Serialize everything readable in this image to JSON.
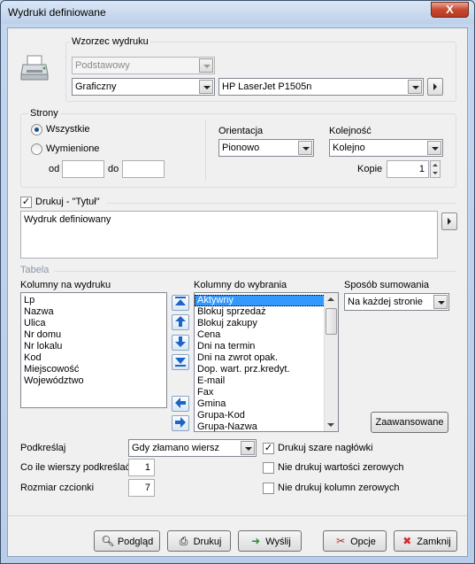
{
  "window": {
    "title": "Wydruki definiowane",
    "close_label": "X"
  },
  "wzorzec": {
    "label": "Wzorzec wydruku",
    "template_value": "Podstawowy",
    "mode_value": "Graficzny",
    "printer_value": "HP LaserJet P1505n"
  },
  "strony": {
    "label": "Strony",
    "all_label": "Wszystkie",
    "listed_label": "Wymienione",
    "from_label": "od",
    "from_value": "",
    "to_label": "do",
    "to_value": ""
  },
  "orientacja": {
    "label": "Orientacja",
    "value": "Pionowo"
  },
  "kolejnosc": {
    "label": "Kolejność",
    "value": "Kolejno"
  },
  "kopie": {
    "label": "Kopie",
    "value": "1"
  },
  "title_section": {
    "checkbox_label": "Drukuj - \"Tytuł\"",
    "text": "Wydruk definiowany"
  },
  "tabela": {
    "label": "Tabela",
    "print_columns_label": "Kolumny na wydruku",
    "print_columns": [
      "Lp",
      "Nazwa",
      "Ulica",
      "Nr domu",
      "Nr lokalu",
      "Kod",
      "Miejscowość",
      "Województwo"
    ],
    "available_columns_label": "Kolumny do wybrania",
    "available_columns": [
      "Aktywny",
      "Blokuj sprzedaż",
      "Blokuj zakupy",
      "Cena",
      "Dni na termin",
      "Dni na zwrot opak.",
      "Dop. wart. prz.kredyt.",
      "E-mail",
      "Fax",
      "Gmina",
      "Grupa-Kod",
      "Grupa-Nazwa"
    ],
    "selected_available": "Aktywny",
    "summing_label": "Sposób sumowania",
    "summing_value": "Na każdej stronie",
    "advanced_label": "Zaawansowane"
  },
  "options": {
    "underline_label": "Podkreślaj",
    "underline_value": "Gdy złamano wiersz",
    "every_rows_label": "Co ile wierszy podkreślać",
    "every_rows_value": "1",
    "font_size_label": "Rozmiar czcionki",
    "font_size_value": "7",
    "gray_headers_label": "Drukuj szare nagłówki",
    "no_zero_values_label": "Nie drukuj wartości zerowych",
    "no_zero_columns_label": "Nie drukuj kolumn zerowych"
  },
  "buttons": {
    "preview": "Podgląd",
    "print": "Drukuj",
    "send": "Wyślij",
    "options": "Opcje",
    "close": "Zamknij"
  },
  "colors": {
    "selection": "#3399ff",
    "titlebar": "#c3d6ee",
    "close": "#c7492f"
  }
}
